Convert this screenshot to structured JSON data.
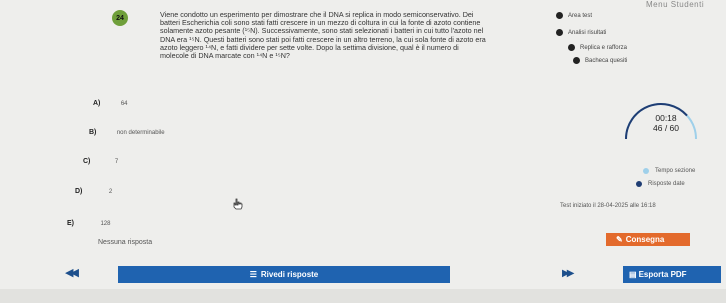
{
  "menu": {
    "title": "Menu Studenti",
    "items": [
      {
        "label": "Area test"
      },
      {
        "label": "Analisi risultati"
      },
      {
        "label": "Replica e rafforza"
      },
      {
        "label": "Bacheca quesiti"
      }
    ]
  },
  "question": {
    "number": "24",
    "lines": [
      "Viene condotto un esperimento per dimostrare che il DNA si replica in modo semiconservativo. Dei",
      "batteri Escherichia coli sono stati fatti crescere in un mezzo di coltura in cui la fonte di azoto contiene",
      "solamente azoto pesante (¹⁵N). Successivamente, sono stati selezionati i batteri in cui tutto l'azoto nel",
      "DNA era ¹⁵N. Questi batteri sono stati poi fatti crescere in un altro terreno, la cui sola fonte di azoto era",
      "azoto leggero ¹⁴N, e fatti dividere per sette volte. Dopo la settima divisione, qual è il numero di",
      "molecole di DNA marcate con ¹⁴N e ¹⁵N?"
    ]
  },
  "options": [
    {
      "letter": "A)",
      "text": "64"
    },
    {
      "letter": "B)",
      "text": "non determinabile"
    },
    {
      "letter": "C)",
      "text": "7"
    },
    {
      "letter": "D)",
      "text": "2"
    },
    {
      "letter": "E)",
      "text": "128"
    }
  ],
  "no_answer_label": "Nessuna risposta",
  "timer": {
    "time": "00:18",
    "progress": "46 / 60",
    "answered": 46,
    "total": 60,
    "legend": [
      {
        "label": "Tempo sezione",
        "color": "#9fd0ea"
      },
      {
        "label": "Risposte date",
        "color": "#1f3d73"
      }
    ]
  },
  "started_text": "Test iniziato il 28-04-2025 alle 16:18",
  "buttons": {
    "submit": "Consegna",
    "review": "Rivedi risposte",
    "export": "Esporta PDF"
  },
  "colors": {
    "accent_blue": "#1f63b0",
    "submit_orange": "#e36a2c",
    "badge_green": "#6f9f3a"
  }
}
